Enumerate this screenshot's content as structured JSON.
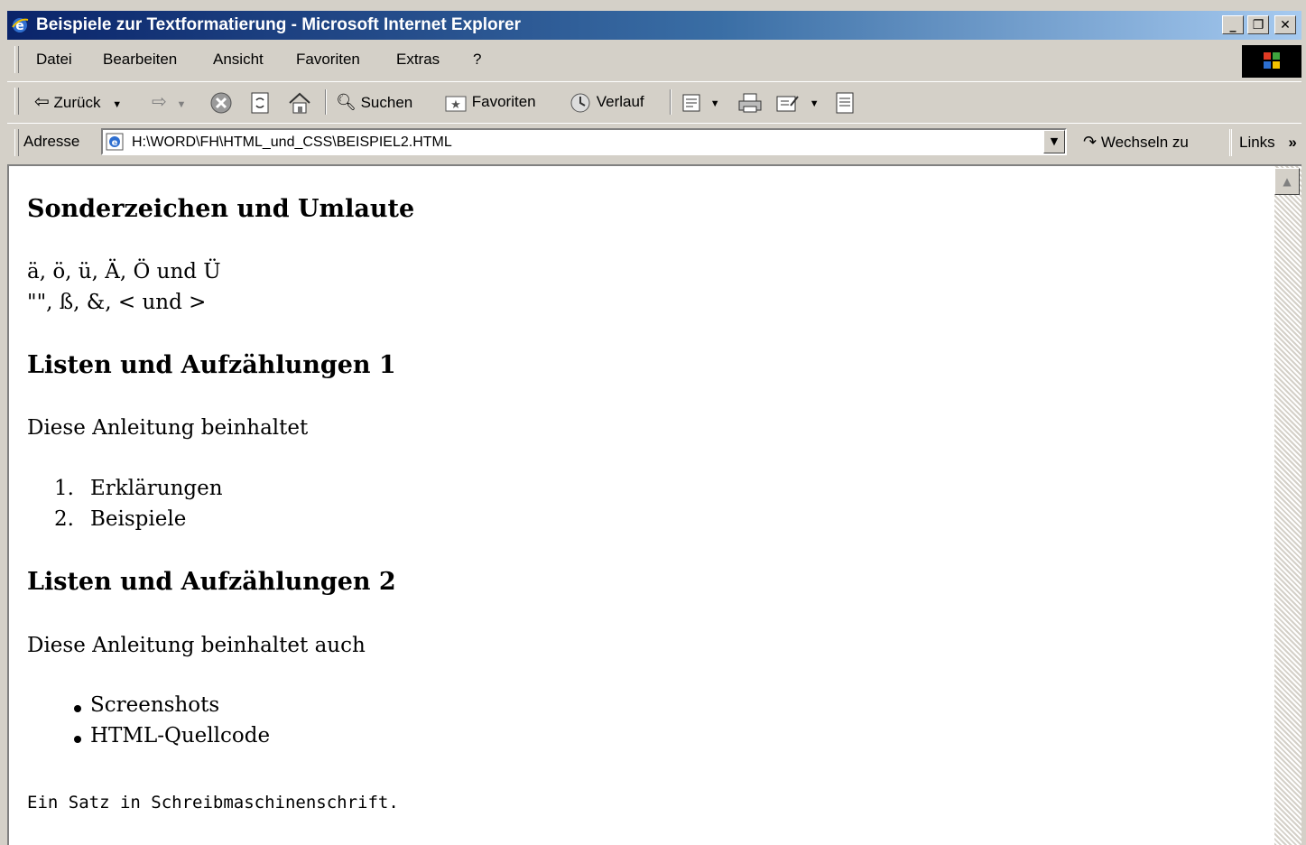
{
  "window": {
    "title": "Beispiele zur Textformatierung - Microsoft Internet Explorer",
    "minimize": "_",
    "maximize": "❐",
    "close": "✕"
  },
  "menu": [
    "Datei",
    "Bearbeiten",
    "Ansicht",
    "Favoriten",
    "Extras",
    "?"
  ],
  "toolbar": {
    "back_label": "Zurück",
    "search_label": "Suchen",
    "favorites_label": "Favoriten",
    "history_label": "Verlauf"
  },
  "address": {
    "label": "Adresse",
    "url": "H:\\WORD\\FH\\HTML_und_CSS\\BEISPIEL2.HTML",
    "go_label": "Wechseln zu",
    "links_label": "Links",
    "links_more": "»"
  },
  "content": {
    "heading1": "Sonderzeichen und Umlaute",
    "line1": "ä, ö, ü, Ä, Ö und Ü",
    "line2": "\"\", ß, &, < und >",
    "heading2": "Listen und Aufzählungen 1",
    "intro1": "Diese Anleitung beinhaltet",
    "ordered_list": [
      {
        "num": "1.",
        "text": "Erklärungen"
      },
      {
        "num": "2.",
        "text": "Beispiele"
      }
    ],
    "heading3": "Listen und Aufzählungen 2",
    "intro2": "Diese Anleitung beinhaltet auch",
    "unordered_list": [
      "Screenshots",
      "HTML-Quellcode"
    ],
    "typewriter": "Ein Satz in Schreibmaschinenschrift."
  },
  "colors": {
    "titlebar_start": "#0a246a",
    "titlebar_end": "#a6caf0",
    "chrome": "#d4d0c8"
  }
}
